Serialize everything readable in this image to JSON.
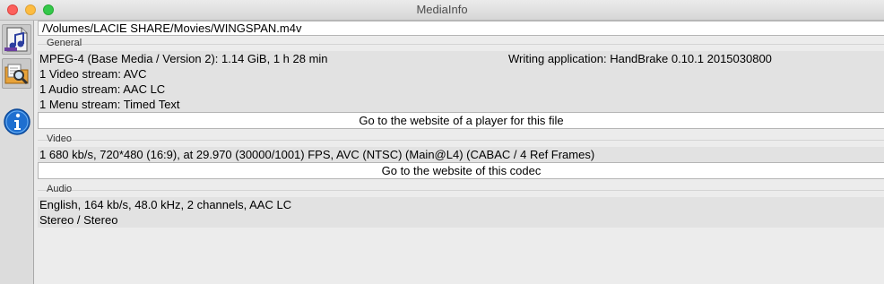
{
  "window": {
    "title": "MediaInfo"
  },
  "sidebar": {
    "items": [
      {
        "name": "open-file",
        "icon": "music-file-icon"
      },
      {
        "name": "open-folder",
        "icon": "folder-search-icon"
      },
      {
        "name": "about",
        "icon": "info-icon"
      }
    ]
  },
  "file_path": "/Volumes/LACIE SHARE/Movies/WINGSPAN.m4v",
  "general": {
    "label": "General",
    "format": "MPEG-4 (Base Media / Version 2): 1.14 GiB, 1 h 28 min",
    "writing_app": "Writing application: HandBrake 0.10.1 2015030800",
    "video_streams": "1 Video stream: AVC",
    "audio_streams": "1 Audio stream: AAC LC",
    "menu_streams": "1 Menu stream: Timed Text",
    "button": "Go to the website of a player for this file"
  },
  "video": {
    "label": "Video",
    "details": "1 680 kb/s, 720*480 (16:9), at 29.970 (30000/1001) FPS, AVC (NTSC) (Main@L4) (CABAC / 4 Ref Frames)",
    "button": "Go to the website of this codec"
  },
  "audio": {
    "label": "Audio",
    "line1": "English, 164 kb/s, 48.0 kHz, 2 channels, AAC LC",
    "line2": "Stereo / Stereo"
  },
  "colors": {
    "close": "#fc605c",
    "minimize": "#fdbc40",
    "maximize": "#34c84a",
    "info": "#1e6fd0"
  }
}
